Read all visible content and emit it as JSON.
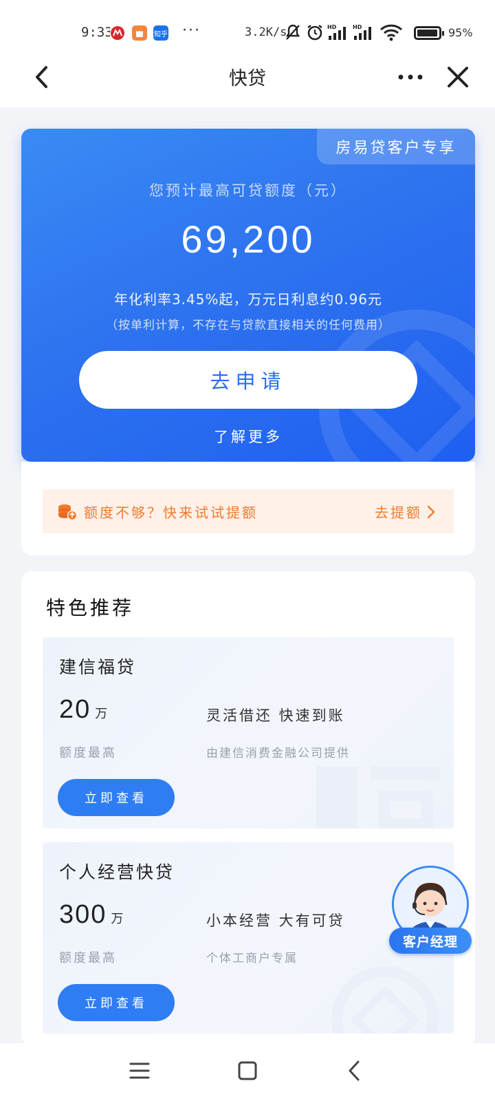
{
  "status_bar": {
    "time": "9:33",
    "app_icons": [
      {
        "name": "china-merchants-bank-icon",
        "color": "#d9262b",
        "label": ""
      },
      {
        "name": "shopping-bag-icon",
        "color": "#f5853d",
        "label": ""
      },
      {
        "name": "zhihu-icon",
        "color": "#1a73e8",
        "label": "知乎"
      }
    ],
    "overflow": "···",
    "net_speed": "3.2K/s",
    "battery_percent": "95%",
    "battery_level": 0.95
  },
  "nav": {
    "title": "快贷",
    "back_icon": "chevron-left-icon",
    "more_icon": "more-dots-icon",
    "close_icon": "close-icon"
  },
  "quota_card": {
    "tag": "房易贷客户专享",
    "label": "您预计最高可贷额度（元）",
    "amount": "69,200",
    "rate_text": "年化利率3.45%起，万元日利息约0.96元",
    "note": "（按单利计算，不存在与贷款直接相关的任何费用）",
    "apply_button": "去申请",
    "learn_more": "了解更多"
  },
  "boost": {
    "text": "额度不够？快来试试提额",
    "link": "去提额",
    "icon": "coin-stack-icon"
  },
  "featured": {
    "title": "特色推荐",
    "products": [
      {
        "name": "建信福贷",
        "amount": "20",
        "unit": "万",
        "amount_label": "额度最高",
        "feature": "灵活借还 快速到账",
        "provider": "由建信消费金融公司提供",
        "button": "立即查看"
      },
      {
        "name": "个人经营快贷",
        "amount": "300",
        "unit": "万",
        "amount_label": "额度最高",
        "feature": "小本经营 大有可贷",
        "provider": "个体工商户专属",
        "button": "立即查看"
      }
    ]
  },
  "customer_manager": {
    "label": "客户经理"
  },
  "system_nav": {
    "icons": [
      "menu-icon",
      "home-square-icon",
      "back-triangle-icon"
    ]
  },
  "colors": {
    "brand_blue": "#2e73ef",
    "accent_orange": "#f07a2e",
    "button_blue": "#2f7df3"
  }
}
